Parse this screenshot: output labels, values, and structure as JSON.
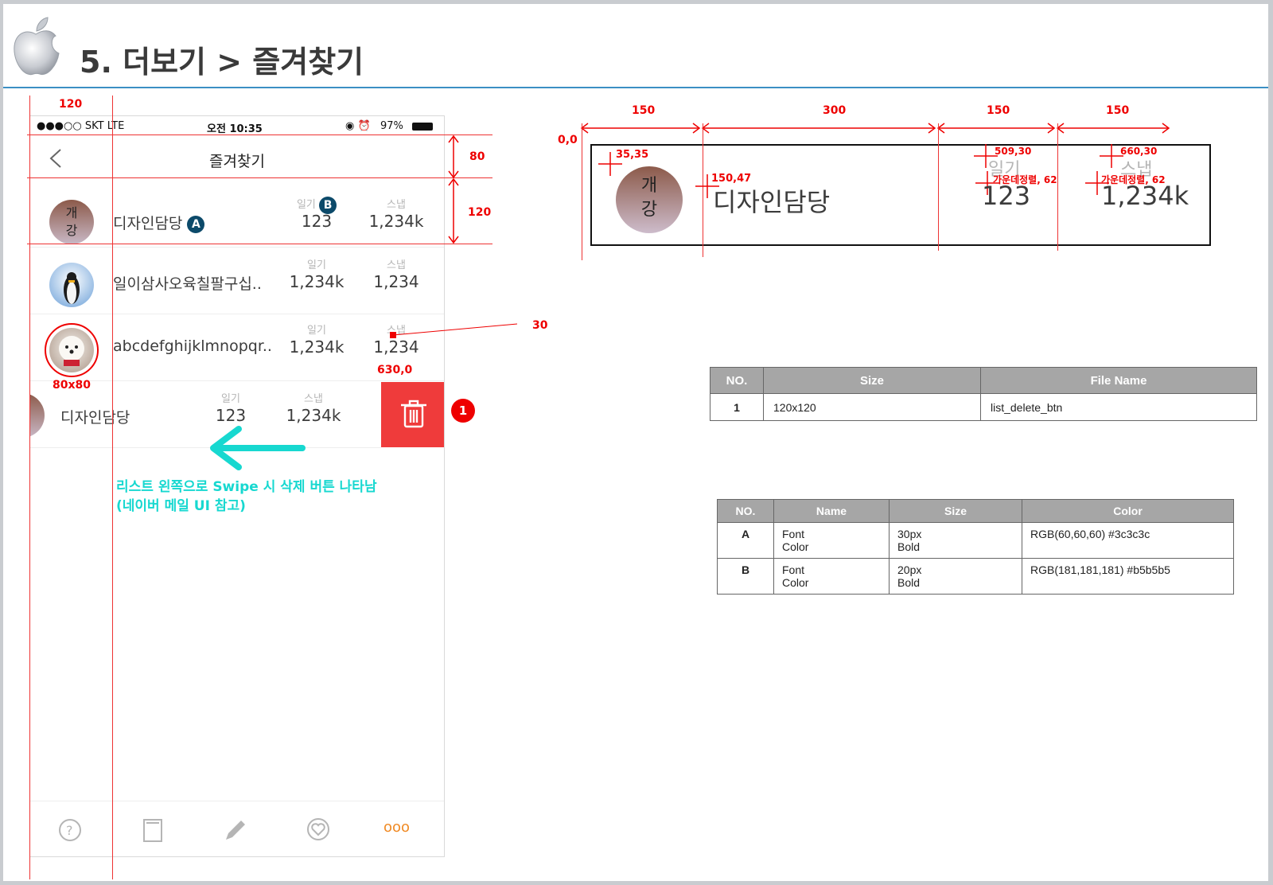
{
  "slide": {
    "title": "5. 더보기 > 즐겨찾기"
  },
  "phone": {
    "status": {
      "carrier": "●●●○○ SKT   LTE",
      "time": "오전 10:35",
      "battery": "97%"
    },
    "nav_title": "즐겨찾기",
    "rows": [
      {
        "name": "디자인담당",
        "name_badge": "A",
        "label1": "일기",
        "label1_badge": "B",
        "value1": "123",
        "label2": "스냅",
        "value2": "1,234k"
      },
      {
        "name": "일이삼사오육칠팔구십..",
        "label1": "일기",
        "value1": "1,234k",
        "label2": "스냅",
        "value2": "1,234"
      },
      {
        "name": "abcdefghijklmnopqr..",
        "label1": "일기",
        "value1": "1,234k",
        "label2": "스냅",
        "value2": "1,234"
      },
      {
        "name": "디자인담당",
        "label1": "일기",
        "value1": "123",
        "label2": "스냅",
        "value2": "1,234k"
      }
    ],
    "avatar_text": [
      "개",
      "강"
    ],
    "tabs": [
      "help-icon",
      "book-icon",
      "pencil-icon",
      "heart-chat-icon",
      "more-icon"
    ],
    "tab_more_label": "ooo",
    "accent_color": "#ef3b3b",
    "more_color": "#f08a24"
  },
  "annotations": {
    "width_left": "120",
    "height_nav": "80",
    "height_row": "120",
    "avatar_size": "80x80",
    "label_dist": "30",
    "delete_pos": "630,0",
    "delete_number": "1",
    "swipe_line1": "리스트 왼쪽으로 Swipe 시 삭제 버튼 나타남",
    "swipe_line2": "(네이버 메일 UI 참고)"
  },
  "spec": {
    "origin": "0,0",
    "col_widths": [
      "150",
      "300",
      "150",
      "150"
    ],
    "avatar_pos": "35,35",
    "name_pos": "150,47",
    "label1_pos": "509,30",
    "label2_pos": "660,30",
    "align_note1": "가운데정렬, 62",
    "align_note2": "가운데정렬, 62",
    "name": "디자인담당",
    "label1": "일기",
    "label2": "스냅",
    "value1": "123",
    "value2": "1,234k",
    "avatar_text": [
      "개",
      "강"
    ]
  },
  "file_table": {
    "headers": [
      "NO.",
      "Size",
      "File Name"
    ],
    "rows": [
      [
        "1",
        "120x120",
        "list_delete_btn"
      ]
    ]
  },
  "font_table": {
    "headers": [
      "NO.",
      "Name",
      "Size",
      "Color"
    ],
    "rows": [
      [
        "A",
        "Font\nColor",
        "30px\nBold",
        "RGB(60,60,60)  #3c3c3c"
      ],
      [
        "B",
        "Font\nColor",
        "20px\nBold",
        "RGB(181,181,181)  #b5b5b5"
      ]
    ]
  }
}
